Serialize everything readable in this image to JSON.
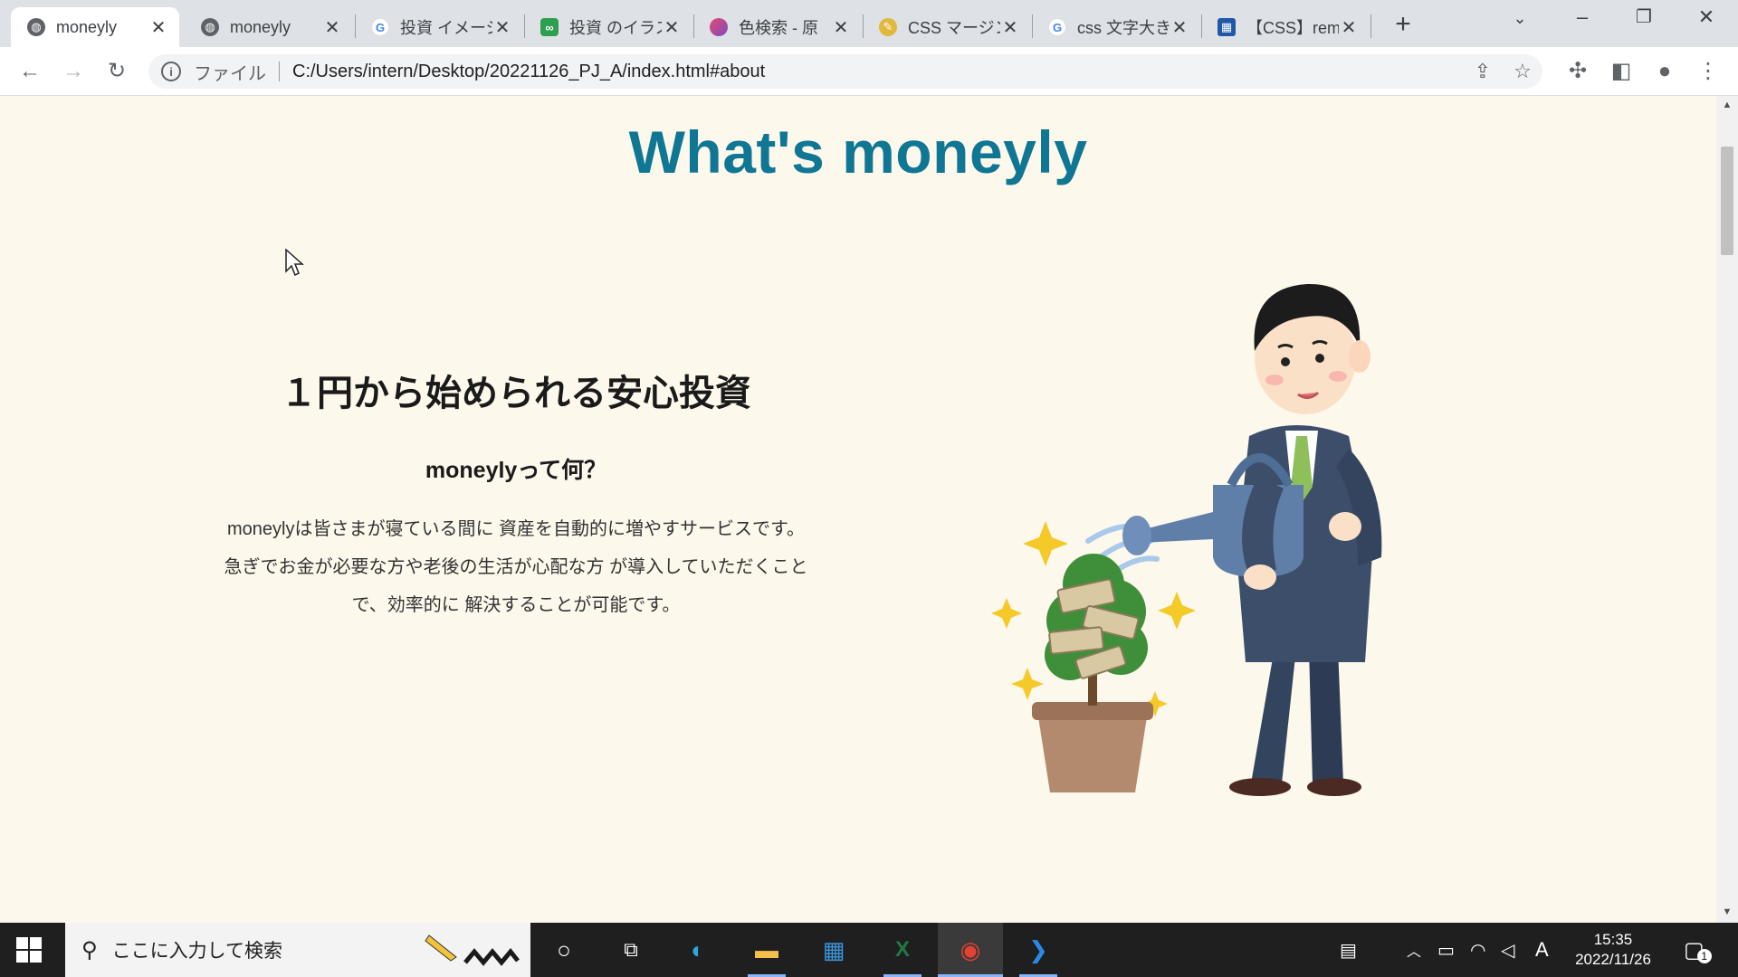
{
  "browser": {
    "tabs": [
      {
        "title": "moneyly",
        "active": true,
        "favicon": "globe-icon"
      },
      {
        "title": "moneyly",
        "active": false,
        "favicon": "globe-icon"
      },
      {
        "title": "投資 イメージ",
        "active": false,
        "favicon": "google-icon"
      },
      {
        "title": "投資 のイラス",
        "active": false,
        "favicon": "irasutoya-icon"
      },
      {
        "title": "色検索 - 原",
        "active": false,
        "favicon": "color-search-icon"
      },
      {
        "title": "CSS マージン",
        "active": false,
        "favicon": "css-site-icon"
      },
      {
        "title": "css 文字大き",
        "active": false,
        "favicon": "google-icon"
      },
      {
        "title": "【CSS】rem",
        "active": false,
        "favicon": "grid-site-icon"
      }
    ],
    "omnibox": {
      "scheme_label": "ファイル",
      "url": "C:/Users/intern/Desktop/20221126_PJ_A/index.html#about"
    }
  },
  "page": {
    "title": "What's moneyly",
    "about": {
      "heading": "１円から始められる安心投資",
      "subheading": "moneylyって何？",
      "body_lines": [
        "moneylyは皆さまが寝ている間に 資産を自動的に増やすサービスです。",
        "急ぎでお金が必要な方や老後の生活が心配な方 が導入していただくこと",
        "で、効率的に 解決することが可能です。"
      ]
    },
    "colors": {
      "title": "#0f7693",
      "background": "#fdf8ec"
    }
  },
  "taskbar": {
    "search_placeholder": "ここに入力して検索",
    "ime_indicator": "A",
    "time": "15:35",
    "date": "2022/11/26",
    "notification_count": "1"
  }
}
